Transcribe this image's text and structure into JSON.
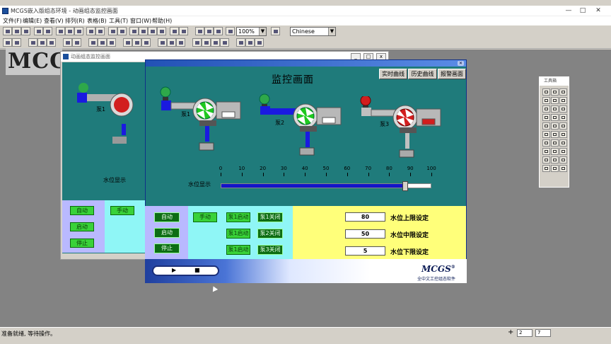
{
  "app": {
    "title": "MCGS嵌入版组态环境 - 动画组态监控画面",
    "menu": [
      "文件(F)",
      "编辑(E)",
      "查看(V)",
      "排列(R)",
      "表格(B)",
      "工具(T)",
      "窗口(W)",
      "帮助(H)"
    ],
    "toolbar": {
      "zoom": "100%",
      "language": "Chinese"
    },
    "window_controls": [
      "—",
      "□",
      "✕"
    ]
  },
  "back_window": {
    "title": "动画组态监控画面",
    "pump_label": "泵1",
    "level_label": "水位显示",
    "buttons": {
      "auto": "自动",
      "start": "启动",
      "stop": "停止",
      "manual": "手动"
    }
  },
  "main_window": {
    "heading": "监控画面",
    "nav": {
      "realtime": "实时曲线",
      "history": "历史曲线",
      "alarm": "报警画面"
    },
    "pumps": [
      {
        "label": "泵1",
        "valve_color": "#2ea84a",
        "fan_color": "#1ec81e"
      },
      {
        "label": "泵2",
        "valve_color": "#2ea84a",
        "fan_color": "#1ec81e"
      },
      {
        "label": "泵3",
        "valve_color": "#d21e1e",
        "fan_color": "#d21e1e"
      }
    ],
    "level": {
      "label": "水位显示",
      "value": 88,
      "ticks": [
        "0",
        "10",
        "20",
        "30",
        "40",
        "50",
        "60",
        "70",
        "80",
        "90",
        "100"
      ]
    },
    "controls": {
      "auto": "自动",
      "start": "启动",
      "stop": "停止",
      "manual": "手动",
      "pump1_start": "泵1启动",
      "pump1_stop": "泵1关闭",
      "pump2_start": "泵1启动",
      "pump2_stop": "泵2关闭",
      "pump3_start": "泵1启动",
      "pump3_stop": "泵3关闭"
    },
    "settings": [
      {
        "value": "80",
        "label": "水位上限设定"
      },
      {
        "value": "50",
        "label": "水位中限设定"
      },
      {
        "value": "5",
        "label": "水位下限设定"
      }
    ],
    "footer": {
      "play": "▶",
      "stop": "■",
      "brand": "MCGS",
      "reg": "®",
      "slogan": "全中文工控组态软件"
    }
  },
  "palette": {
    "title": "工具箱"
  },
  "status": {
    "message": "准备就绪, 等待操作。",
    "coord_a": "2",
    "coord_b": "7"
  }
}
